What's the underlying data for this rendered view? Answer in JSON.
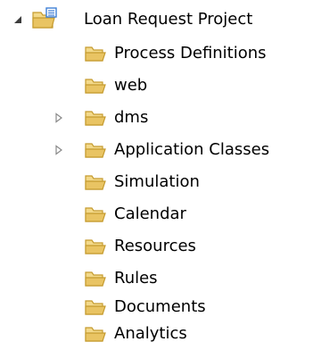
{
  "tree": {
    "root": {
      "label": "Loan Request Project",
      "expanded": true,
      "icon": "project-folder-icon"
    },
    "children": [
      {
        "label": "Process Definitions",
        "expandable": false,
        "icon": "folder-open-icon"
      },
      {
        "label": "web",
        "expandable": false,
        "icon": "folder-open-icon"
      },
      {
        "label": "dms",
        "expandable": true,
        "icon": "folder-open-icon"
      },
      {
        "label": "Application Classes",
        "expandable": true,
        "icon": "folder-open-icon"
      },
      {
        "label": "Simulation",
        "expandable": false,
        "icon": "folder-open-icon"
      },
      {
        "label": "Calendar",
        "expandable": false,
        "icon": "folder-open-icon"
      },
      {
        "label": "Resources",
        "expandable": false,
        "icon": "folder-open-icon"
      },
      {
        "label": "Rules",
        "expandable": false,
        "icon": "folder-open-icon"
      },
      {
        "label": "Documents",
        "expandable": false,
        "icon": "folder-open-icon"
      },
      {
        "label": "Analytics",
        "expandable": false,
        "icon": "folder-open-icon"
      }
    ],
    "colors": {
      "folder_fill": "#f3d98a",
      "folder_stroke": "#c59b2f",
      "folder_inner": "#e9c463",
      "project_badge": "#3f7fd6",
      "twisty_expanded": "#3c3c3c",
      "twisty_collapsed": "#8a8a8a"
    }
  }
}
